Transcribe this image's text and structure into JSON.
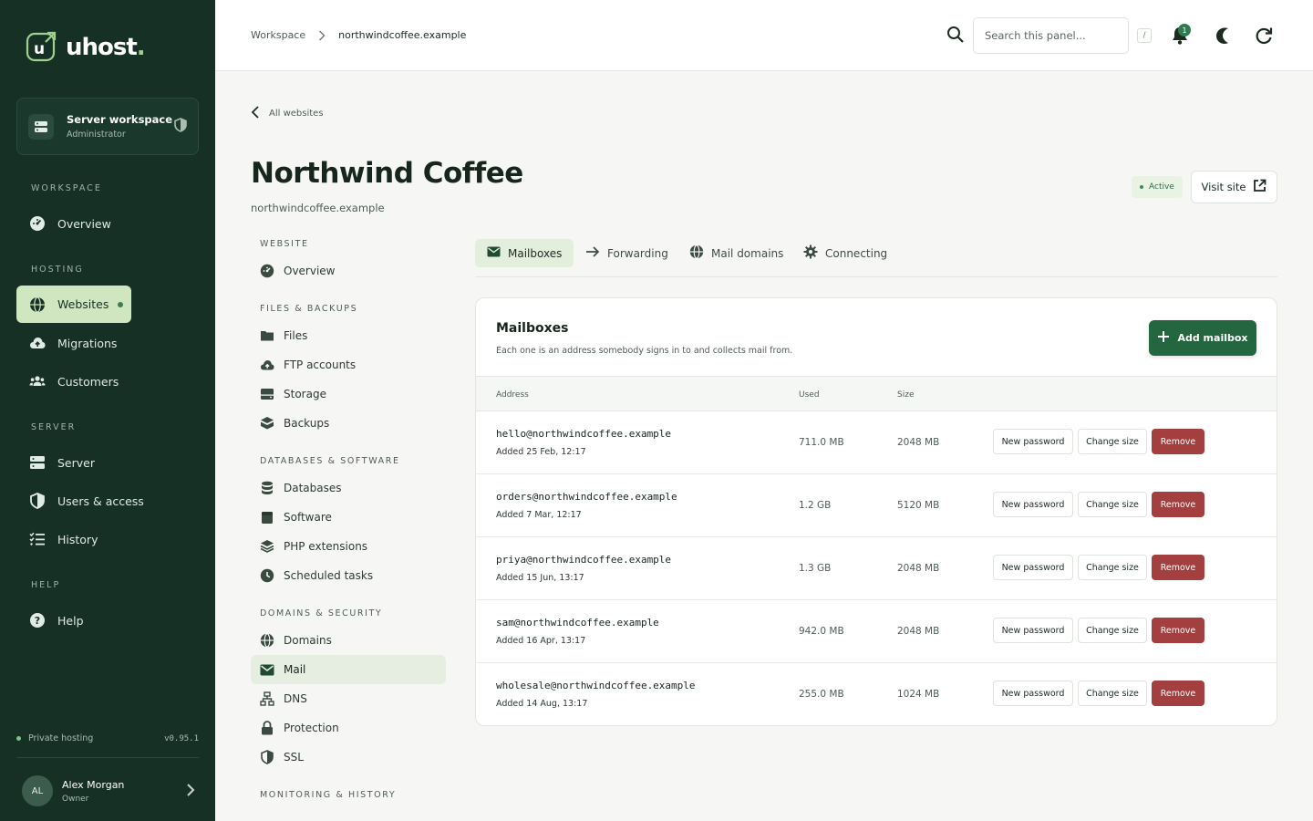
{
  "brand": {
    "name": "uhost",
    "dot": ".",
    "mark_letter": "u"
  },
  "workspace_card": {
    "title": "Server workspace",
    "subtitle": "Administrator"
  },
  "sidebar": {
    "sections": [
      {
        "label": "WORKSPACE",
        "items": [
          {
            "label": "Overview",
            "icon": "dashboard-icon"
          }
        ]
      },
      {
        "label": "HOSTING",
        "items": [
          {
            "label": "Websites",
            "icon": "globe-icon",
            "active": true
          },
          {
            "label": "Migrations",
            "icon": "cloud-upload-icon"
          },
          {
            "label": "Customers",
            "icon": "users-icon"
          }
        ]
      },
      {
        "label": "SERVER",
        "items": [
          {
            "label": "Server",
            "icon": "server-icon"
          },
          {
            "label": "Users & access",
            "icon": "shield-icon"
          },
          {
            "label": "History",
            "icon": "list-check-icon"
          }
        ]
      },
      {
        "label": "HELP",
        "items": [
          {
            "label": "Help",
            "icon": "help-icon"
          }
        ]
      }
    ],
    "footer": {
      "status": "Private hosting",
      "version": "v0.95.1"
    },
    "user": {
      "initials": "AL",
      "name": "Alex Morgan",
      "role": "Owner"
    }
  },
  "topbar": {
    "breadcrumb": [
      "Workspace",
      "northwindcoffee.example"
    ],
    "search_placeholder": "Search this panel...",
    "search_shortcut": "/",
    "notification_count": "1"
  },
  "page": {
    "back_label": "All websites",
    "title": "Northwind Coffee",
    "subtitle": "northwindcoffee.example",
    "status": "Active",
    "visit_label": "Visit site"
  },
  "subnav": [
    {
      "label": "WEBSITE",
      "items": [
        {
          "label": "Overview",
          "icon": "dashboard-icon"
        }
      ]
    },
    {
      "label": "FILES & BACKUPS",
      "items": [
        {
          "label": "Files",
          "icon": "folder-icon"
        },
        {
          "label": "FTP accounts",
          "icon": "cloud-upload-icon"
        },
        {
          "label": "Storage",
          "icon": "storage-icon"
        },
        {
          "label": "Backups",
          "icon": "box-icon"
        }
      ]
    },
    {
      "label": "DATABASES & SOFTWARE",
      "items": [
        {
          "label": "Databases",
          "icon": "database-icon"
        },
        {
          "label": "Software",
          "icon": "package-icon"
        },
        {
          "label": "PHP extensions",
          "icon": "layers-icon"
        },
        {
          "label": "Scheduled tasks",
          "icon": "clock-icon"
        }
      ]
    },
    {
      "label": "DOMAINS & SECURITY",
      "items": [
        {
          "label": "Domains",
          "icon": "globe-icon"
        },
        {
          "label": "Mail",
          "icon": "mail-icon",
          "active": true
        },
        {
          "label": "DNS",
          "icon": "network-icon"
        },
        {
          "label": "Protection",
          "icon": "lock-icon"
        },
        {
          "label": "SSL",
          "icon": "shield-icon"
        }
      ]
    },
    {
      "label": "MONITORING & HISTORY",
      "items": []
    }
  ],
  "tabs": [
    {
      "label": "Mailboxes",
      "icon": "mail-icon",
      "active": true
    },
    {
      "label": "Forwarding",
      "icon": "arrow-right-icon"
    },
    {
      "label": "Mail domains",
      "icon": "globe-icon"
    },
    {
      "label": "Connecting",
      "icon": "gear-icon"
    }
  ],
  "mailboxes": {
    "title": "Mailboxes",
    "description": "Each one is an address somebody signs in to and collects mail from.",
    "add_label": "Add mailbox",
    "columns": {
      "address": "Address",
      "used": "Used",
      "size": "Size"
    },
    "actions": {
      "new_password": "New password",
      "change_size": "Change size",
      "remove": "Remove"
    },
    "rows": [
      {
        "address": "hello@northwindcoffee.example",
        "added": "Added 25 Feb, 12:17",
        "used": "711.0 MB",
        "size": "2048 MB"
      },
      {
        "address": "orders@northwindcoffee.example",
        "added": "Added 7 Mar, 12:17",
        "used": "1.2 GB",
        "size": "5120 MB"
      },
      {
        "address": "priya@northwindcoffee.example",
        "added": "Added 15 Jun, 13:17",
        "used": "1.3 GB",
        "size": "2048 MB"
      },
      {
        "address": "sam@northwindcoffee.example",
        "added": "Added 16 Apr, 13:17",
        "used": "942.0 MB",
        "size": "2048 MB"
      },
      {
        "address": "wholesale@northwindcoffee.example",
        "added": "Added 14 Aug, 13:17",
        "used": "255.0 MB",
        "size": "1024 MB"
      }
    ]
  }
}
